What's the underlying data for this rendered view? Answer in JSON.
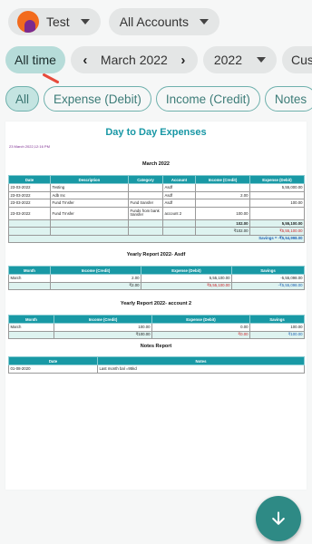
{
  "top": {
    "profile_name": "Test",
    "account_selector": "All Accounts",
    "period": "All time",
    "month": "March 2022",
    "year": "2022",
    "custom_partial": "Cust"
  },
  "filters": [
    "All",
    "Expense (Debit)",
    "Income (Credit)",
    "Notes"
  ],
  "report": {
    "title": "Day to Day Expenses",
    "generated": "23 March 2022,12:16 PM",
    "month_section": {
      "heading": "March 2022",
      "columns": [
        "Date",
        "Description",
        "Category",
        "Account",
        "Income (Credit)",
        "Expense (Debit)"
      ],
      "rows": [
        [
          "23-03-2022",
          "Testing",
          "",
          "Asdf",
          "",
          "5,55,000.00"
        ],
        [
          "23-03-2022",
          "Adb Inc",
          "",
          "Asdf",
          "2.00",
          ""
        ],
        [
          "23-03-2022",
          "Fund Trnsfer",
          "Fund transfer",
          "Asdf",
          "",
          "100.00"
        ],
        [
          "23-03-2022",
          "Fund Trnsfer",
          "Funds from bank transfer",
          "account 2",
          "100.00",
          ""
        ]
      ],
      "total1_income": "102.00",
      "total1_expense": "5,55,100.00",
      "total2_income": "₹102.00",
      "total2_expense": "₹5,55,100.00",
      "savings": "Savings = -₹5,54,998.00"
    },
    "yearly_asdf": {
      "heading": "Yearly Report 2022- Asdf",
      "columns": [
        "Month",
        "Income (Credit)",
        "Expense (Debit)",
        "Savings"
      ],
      "row": [
        "March",
        "2.00",
        "5,55,100.00",
        "-5,55,098.00"
      ],
      "total": [
        "",
        "₹2.00",
        "₹5,55,100.00",
        "-₹5,55,098.00"
      ]
    },
    "yearly_account2": {
      "heading": "Yearly Report 2022- account 2",
      "columns": [
        "Month",
        "Income (Credit)",
        "Expense (Debit)",
        "Savings"
      ],
      "row": [
        "March",
        "100.00",
        "0.00",
        "100.00"
      ],
      "total": [
        "",
        "₹100.00",
        "₹0.00",
        "₹100.00"
      ]
    },
    "notes": {
      "heading": "Notes Report",
      "columns": [
        "Date",
        "Notes"
      ],
      "row": [
        "01-08-2020",
        "Last month bal =95kd"
      ]
    }
  },
  "colors": {
    "accent": "#1999a5",
    "active_pill": "#b6dcd9",
    "fab": "#2e8a85",
    "expense_red": "#d0242a",
    "savings_blue": "#1f62b4"
  },
  "icons": {
    "fab": "arrow-down-icon",
    "prev": "chevron-left-icon",
    "next": "chevron-right-icon"
  }
}
